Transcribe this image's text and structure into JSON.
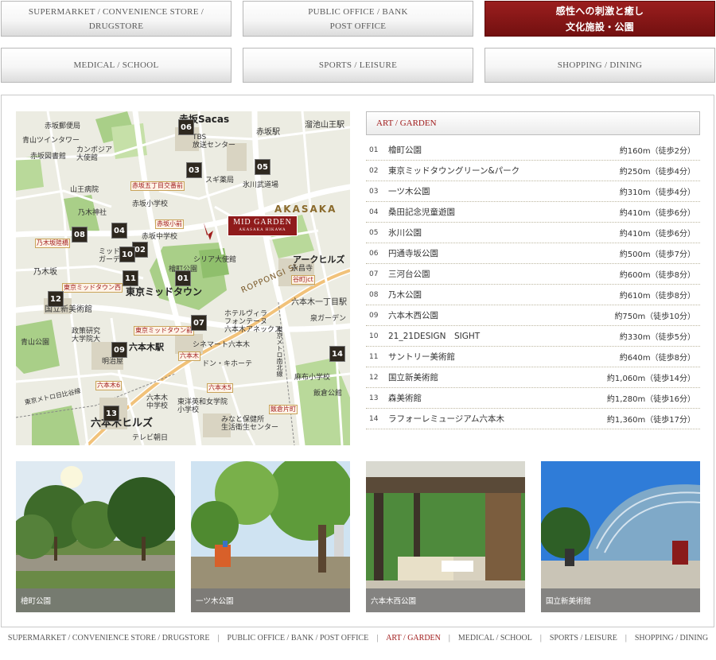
{
  "tabs": [
    {
      "label": "SUPERMARKET / CONVENIENCE STORE /\nDRUGSTORE",
      "active": false
    },
    {
      "label": "PUBLIC OFFICE / BANK\nPOST OFFICE",
      "active": false
    },
    {
      "label": "感性への刺激と癒し\n文化施設・公園",
      "active": true
    },
    {
      "label": "MEDICAL / SCHOOL",
      "active": false
    },
    {
      "label": "SPORTS / LEISURE",
      "active": false
    },
    {
      "label": "SHOPPING / DINING",
      "active": false
    }
  ],
  "map": {
    "mid_garden": {
      "title": "MID GARDEN",
      "sub": "AKASAKA HIKAWA"
    },
    "labels": {
      "akasaka_sacas": "赤坂Sacas",
      "akasaka_sta": "赤坂駅",
      "tameike": "溜池山王駅",
      "tbs": "TBS\n放送センター",
      "akasaka_post": "赤坂郵便局",
      "aoyama_twin": "青山ツインタワー",
      "cambodia": "カンボジア\n大使館",
      "akasaka_library": "赤坂図書館",
      "sanno": "山王病院",
      "nogi_shrine": "乃木神社",
      "akasaka_elem": "赤坂小学校",
      "akasaka_jhs": "赤坂中学校",
      "syria": "シリア大使館",
      "hikawa_shrine": "氷川武道場",
      "sugi": "スギ薬局",
      "akasaka_big": "AKASAKA",
      "ark_hills": "アークヒルズ",
      "nogizaka": "乃木坂",
      "tokyo_midtown": "東京ミッドタウン",
      "national_art_center": "国立新美術館",
      "seisaku": "政策研究\n大学院大",
      "aoyama_park": "青山公園",
      "roppongi_sta": "六本木駅",
      "meijiya": "明治屋",
      "roppongi_hills": "六本木ヒルズ",
      "tv_asahi": "テレビ朝日",
      "roppongi_1": "六本木一丁目駅",
      "izumi_garden": "泉ガーデン",
      "hotel_villa": "ホテルヴィラ\nフォンテーヌ\n六本木アネックス",
      "cinemart": "シネマート六本木",
      "donki": "ドン・キホーテ",
      "roppongi_jhs": "六本木\n中学校",
      "toyoeiwa": "東洋英和女学院\n小学校",
      "minato_center": "みなと保健所\n生活衛生センター",
      "azabu_elem": "麻布小学校",
      "iikura": "飯倉公館",
      "nanboku": "東京メトロ南北線",
      "hibiya": "東京メトロ日比谷線",
      "roppongi_road": "ROPPONGI St.",
      "akasaka_5": "赤坂五丁目交番前",
      "akasaka_sho": "赤坂小前",
      "nogizaka_ue": "乃木坂陸橋",
      "midtown_w": "東京ミッドタウン西",
      "midtown_mae": "東京ミッドタウン前",
      "roppongi_6": "六本木6",
      "roppongi_5": "六本木5",
      "roppongi_int": "六本木",
      "iikura_kata": "飯倉片町",
      "tanimachi": "谷町jct",
      "eigenji": "永昌寺",
      "hinokicho": "檜町公園",
      "midorisato": "ミッドタ\nガーデ"
    },
    "markers": [
      "01",
      "02",
      "03",
      "04",
      "05",
      "06",
      "07",
      "08",
      "09",
      "10",
      "11",
      "12",
      "13",
      "14"
    ]
  },
  "list": {
    "header": "ART / GARDEN",
    "items": [
      {
        "num": "01",
        "name": "檜町公園",
        "dist": "約160m（徒歩2分）"
      },
      {
        "num": "02",
        "name": "東京ミッドタウングリーン&パーク",
        "dist": "約250m（徒歩4分）"
      },
      {
        "num": "03",
        "name": "一ツ木公園",
        "dist": "約310m（徒歩4分）"
      },
      {
        "num": "04",
        "name": "桑田記念児童遊園",
        "dist": "約410m（徒歩6分）"
      },
      {
        "num": "05",
        "name": "氷川公園",
        "dist": "約410m（徒歩6分）"
      },
      {
        "num": "06",
        "name": "円通寺坂公園",
        "dist": "約500m（徒歩7分）"
      },
      {
        "num": "07",
        "name": "三河台公園",
        "dist": "約600m（徒歩8分）"
      },
      {
        "num": "08",
        "name": "乃木公園",
        "dist": "約610m（徒歩8分）"
      },
      {
        "num": "09",
        "name": "六本木西公園",
        "dist": "約750m（徒歩10分）"
      },
      {
        "num": "10",
        "name": "21_21DESIGN　SIGHT",
        "dist": "約330m（徒歩5分）"
      },
      {
        "num": "11",
        "name": "サントリー美術館",
        "dist": "約640m（徒歩8分）"
      },
      {
        "num": "12",
        "name": "国立新美術館",
        "dist": "約1,060m（徒歩14分）"
      },
      {
        "num": "13",
        "name": "森美術館",
        "dist": "約1,280m（徒歩16分）"
      },
      {
        "num": "14",
        "name": "ラフォーレミュージアム六本木",
        "dist": "約1,360m（徒歩17分）"
      }
    ]
  },
  "photos": [
    {
      "caption": "檜町公園"
    },
    {
      "caption": "一ツ木公園"
    },
    {
      "caption": "六本木西公園"
    },
    {
      "caption": "国立新美術館"
    }
  ],
  "footer": [
    {
      "label": "SUPERMARKET / CONVENIENCE STORE / DRUGSTORE",
      "active": false
    },
    {
      "label": "PUBLIC OFFICE / BANK / POST OFFICE",
      "active": false
    },
    {
      "label": "ART / GARDEN",
      "active": true
    },
    {
      "label": "MEDICAL / SCHOOL",
      "active": false
    },
    {
      "label": "SPORTS / LEISURE",
      "active": false
    },
    {
      "label": "SHOPPING / DINING",
      "active": false
    }
  ],
  "colors": {
    "accent": "#8f1b1b",
    "accent_text": "#a01c1c",
    "marker": "#2e281f",
    "map_bg": "#ecece2",
    "park_green": "#a9cf88"
  }
}
